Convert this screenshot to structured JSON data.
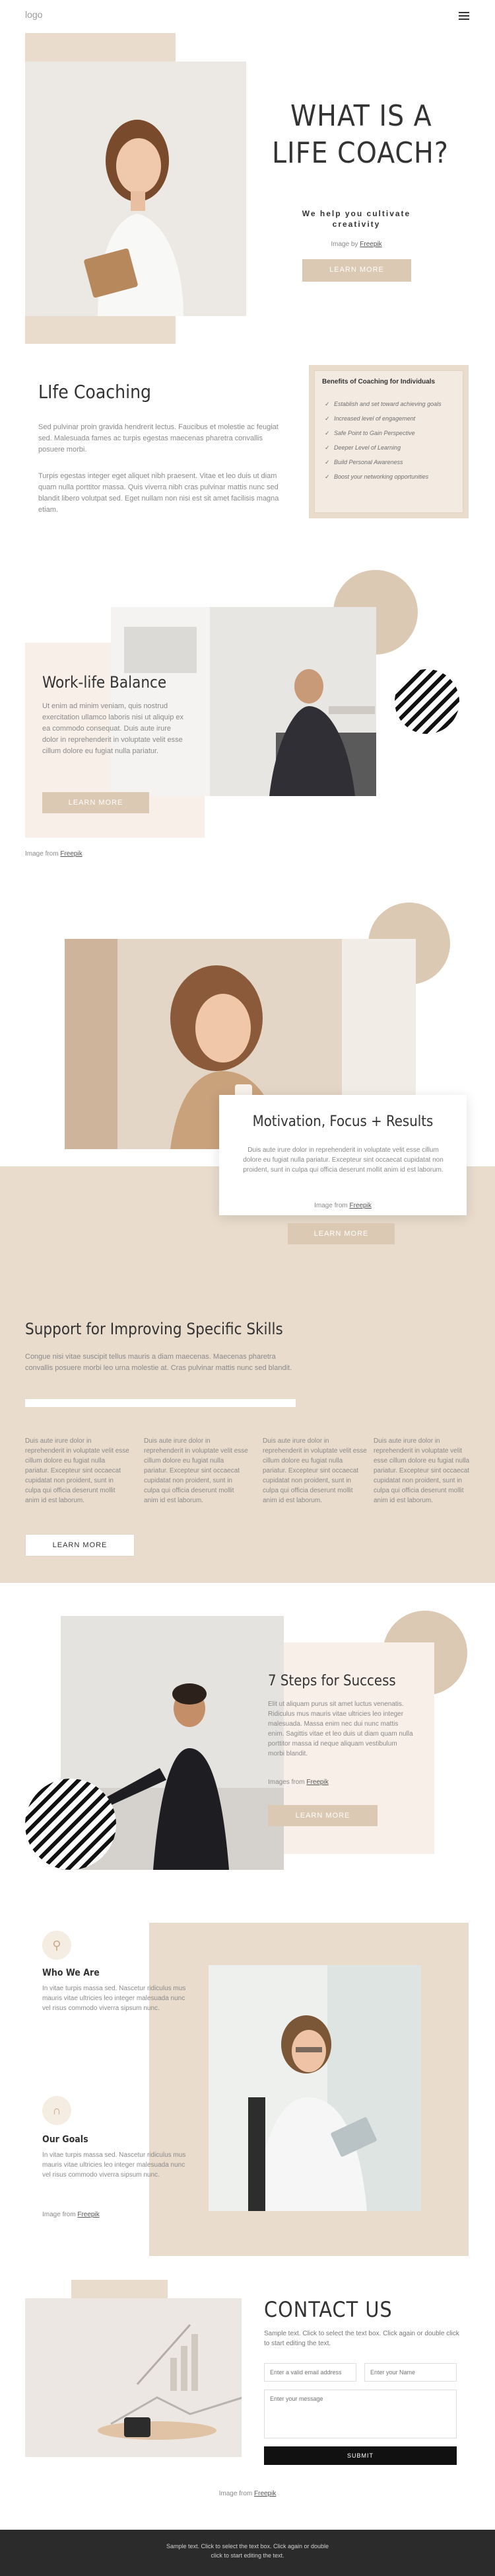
{
  "header": {
    "logo": "logo",
    "menu_icon": "hamburger-icon"
  },
  "hero": {
    "title_line1": "WHAT IS A",
    "title_line2": "LIFE COACH?",
    "subtitle_line1": "We help you cultivate",
    "subtitle_line2": "creativity",
    "image_from": "Image by",
    "image_link": "Freepik",
    "button": "LEARN MORE"
  },
  "coaching": {
    "title": "LIfe Coaching",
    "para1": "Sed pulvinar proin gravida hendrerit lectus. Faucibus et molestie ac feugiat sed. Malesuada fames ac turpis egestas maecenas pharetra convallis posuere morbi.",
    "para2": "Turpis egestas integer eget aliquet nibh praesent. Vitae et leo duis ut diam quam nulla porttitor massa. Quis viverra nibh cras pulvinar mattis nunc sed blandit libero volutpat sed. Eget nullam non nisi est sit amet facilisis magna etiam.",
    "benefits_title": "Benefits of Coaching for Individuals",
    "benefits": [
      "Establish and set toward achieving goals",
      "Increased level of engagement",
      "Safe Point to Gain Perspective",
      "Deeper Level of Learning",
      "Build Personal Awareness",
      "Boost your networking opportunities"
    ]
  },
  "worklife": {
    "title": "Work-life Balance",
    "text": "Ut enim ad minim veniam, quis nostrud exercitation ullamco laboris nisi ut aliquip ex ea commodo consequat. Duis aute irure dolor in reprehenderit in voluptate velit esse cillum dolore eu fugiat nulla pariatur.",
    "button": "LEARN MORE",
    "image_from": "Image from",
    "image_link": "Freepik"
  },
  "motivation": {
    "title": "Motivation, Focus + Results",
    "text": "Duis aute irure dolor in reprehenderit in voluptate velit esse cillum dolore eu fugiat nulla pariatur. Excepteur sint occaecat cupidatat non proident, sunt in culpa qui officia deserunt mollit anim id est laborum.",
    "image_from": "Image from",
    "image_link": "Freepik",
    "button": "LEARN MORE"
  },
  "skills": {
    "title": "Support for Improving Specific Skills",
    "intro": "Congue nisi vitae suscipit tellus mauris a diam maecenas. Maecenas pharetra convallis posuere morbi leo urna molestie at. Cras pulvinar mattis nunc sed blandit.",
    "columns": [
      "Duis aute irure dolor in reprehenderit in voluptate velit esse cillum dolore eu fugiat nulla pariatur. Excepteur sint occaecat cupidatat non proident, sunt in culpa qui officia deserunt mollit anim id est laborum.",
      "Duis aute irure dolor in reprehenderit in voluptate velit esse cillum dolore eu fugiat nulla pariatur. Excepteur sint occaecat cupidatat non proident, sunt in culpa qui officia deserunt mollit anim id est laborum.",
      "Duis aute irure dolor in reprehenderit in voluptate velit esse cillum dolore eu fugiat nulla pariatur. Excepteur sint occaecat cupidatat non proident, sunt in culpa qui officia deserunt mollit anim id est laborum.",
      "Duis aute irure dolor in reprehenderit in voluptate velit esse cillum dolore eu fugiat nulla pariatur. Excepteur sint occaecat cupidatat non proident, sunt in culpa qui officia deserunt mollit anim id est laborum."
    ],
    "button": "LEARN MORE"
  },
  "steps": {
    "title": "7 Steps for Success",
    "text": "Elit ut aliquam purus sit amet luctus venenatis. Ridiculus mus mauris vitae ultricies leo integer malesuada. Massa enim nec dui nunc mattis enim. Sagittis vitae et leo duis ut diam quam nulla porttitor massa id neque aliquam vestibulum morbi blandit.",
    "image_from": "Images from",
    "image_link": "Freepik",
    "button": "LEARN MORE"
  },
  "about": {
    "who_title": "Who We Are",
    "who_text": "In vitae turpis massa sed. Nascetur ridiculus mus mauris vitae ultricies leo integer malesuada nunc vel risus commodo viverra sipsum nunc.",
    "goals_title": "Our Goals",
    "goals_text": "In vitae turpis massa sed. Nascetur ridiculus mus mauris vitae ultricies leo integer malesuada nunc vel risus commodo viverra sipsum nunc.",
    "image_from": "Image from",
    "image_link": "Freepik"
  },
  "contact": {
    "title": "CONTACT US",
    "text": "Sample text. Click to select the text box. Click again or double click to start editing the text.",
    "email_placeholder": "Enter a valid email address",
    "name_placeholder": "Enter your Name",
    "message_placeholder": "Enter your message",
    "submit": "SUBMIT",
    "image_from": "Image from",
    "image_link": "Freepik"
  },
  "footer": {
    "line1": "Sample text. Click to select the text box. Click again or double",
    "line2": "click to start editing the text."
  },
  "colors": {
    "tan": "#e9dccd",
    "tan_dark": "#dcc9b4",
    "pale": "#f7efe8",
    "footer": "#2b2b2b"
  }
}
